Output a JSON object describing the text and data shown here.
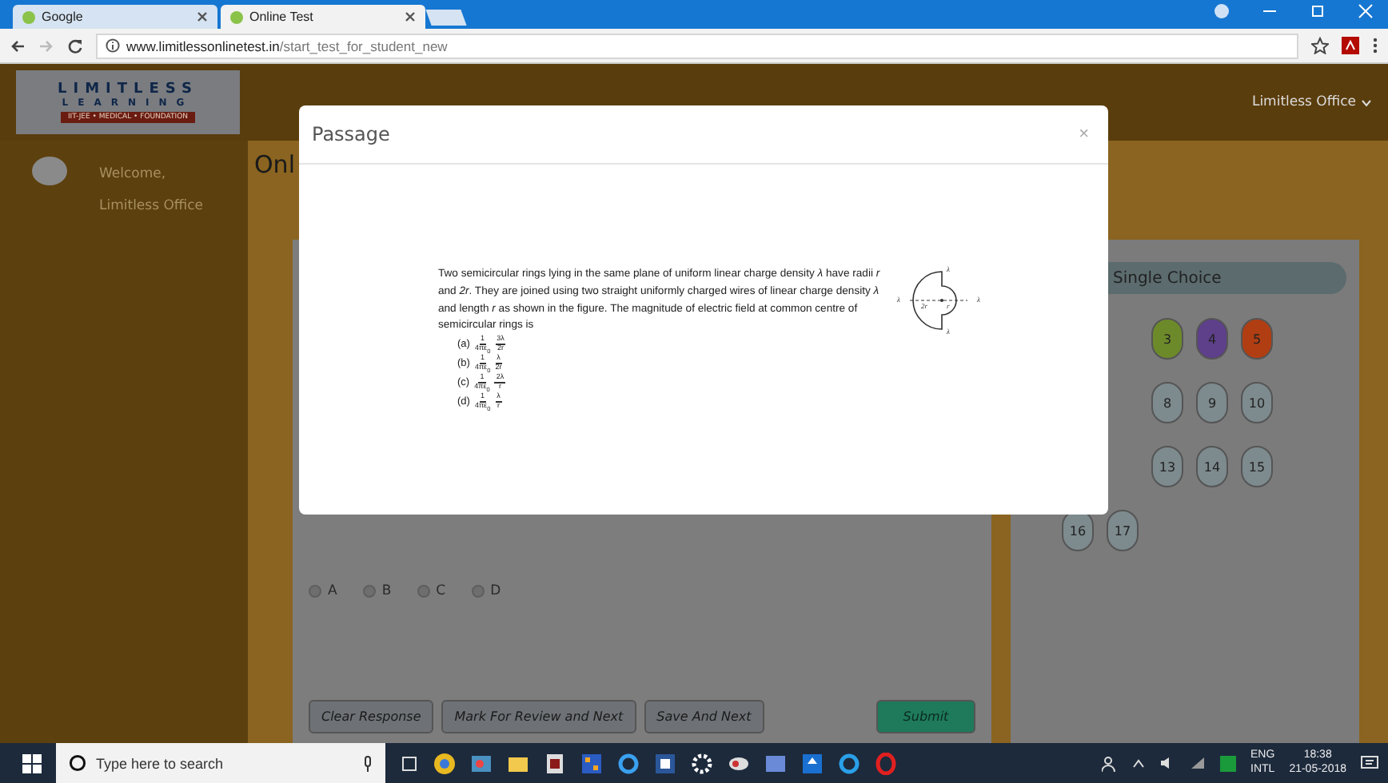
{
  "browser": {
    "tabs": [
      {
        "title": "Google",
        "selected": false
      },
      {
        "title": "Online Test",
        "selected": true
      }
    ],
    "url_host": "www.limitlessonlinetest.in",
    "url_path": "/start_test_for_student_new"
  },
  "header": {
    "logo": {
      "line1": "LIMITLESS",
      "line2": "LEARNING",
      "tagline": "IIT-JEE • MEDICAL • FOUNDATION"
    },
    "user_menu": "Limitless Office"
  },
  "sidebar": {
    "greeting": "Welcome,",
    "user_name": "Limitless Office"
  },
  "page_title": "Onl",
  "answer_options": [
    {
      "label": "A",
      "selected": false
    },
    {
      "label": "B",
      "selected": false
    },
    {
      "label": "C",
      "selected": false
    },
    {
      "label": "D",
      "selected": false
    }
  ],
  "buttons": [
    {
      "label": "Clear Response",
      "kind": "secondary"
    },
    {
      "label": "Mark For Review and Next",
      "kind": "secondary"
    },
    {
      "label": "Save And Next",
      "kind": "secondary"
    },
    {
      "label": "Submit",
      "kind": "primary"
    }
  ],
  "palette": {
    "title": "Single Choice",
    "numbers": [
      {
        "label": "3",
        "color": "#6d8a2a"
      },
      {
        "label": "4",
        "color": "#5e3f8a"
      },
      {
        "label": "5",
        "color": "#b03e12"
      },
      {
        "label": "8",
        "color": "#7d8a8e"
      },
      {
        "label": "9",
        "color": "#7d8a8e"
      },
      {
        "label": "10",
        "color": "#7d8a8e"
      },
      {
        "label": "13",
        "color": "#7d8a8e"
      },
      {
        "label": "14",
        "color": "#7d8a8e"
      },
      {
        "label": "15",
        "color": "#7d8a8e"
      },
      {
        "label": "16",
        "color": "#7d8a8e"
      },
      {
        "label": "17",
        "color": "#7d8a8e"
      }
    ]
  },
  "modal": {
    "title": "Passage",
    "close": "×",
    "question": "Two semicircular rings lying in the same plane of uniform linear charge density *λ* have radii *r* and *2r*. They are joined using two straight uniformly charged wires of linear charge density *λ* and length *r* as shown in the figure. The magnitude of electric field at common centre of semicircular rings is",
    "options": [
      {
        "label": "(a)",
        "fractions": [
          {
            "num": "1",
            "den": "4πε$_{0}$"
          },
          {
            "num": "3λ",
            "den": "2r"
          }
        ]
      },
      {
        "label": "(b)",
        "fractions": [
          {
            "num": "1",
            "den": "4πε$_{0}$"
          },
          {
            "num": "λ",
            "den": "2r"
          }
        ]
      },
      {
        "label": "(c)",
        "fractions": [
          {
            "num": "1",
            "den": "4πε$_{0}$"
          },
          {
            "num": "2λ",
            "den": "r"
          }
        ]
      },
      {
        "label": "(d)",
        "fractions": [
          {
            "num": "1",
            "den": "4πε$_{0}$"
          },
          {
            "num": "λ",
            "den": "r"
          }
        ]
      }
    ],
    "figure": {
      "labels": [
        "λ",
        "λ",
        "λ",
        "λ"
      ],
      "inner": [
        "2r",
        "r"
      ]
    }
  },
  "taskbar": {
    "search_placeholder": "Type here to search",
    "language": "ENG",
    "layout": "INTL",
    "time": "18:38",
    "date": "21-05-2018"
  }
}
